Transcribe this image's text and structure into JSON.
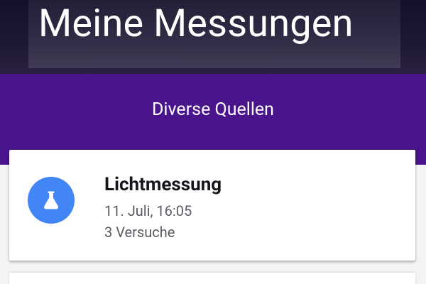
{
  "header": {
    "title": "Meine Messungen"
  },
  "section": {
    "title": "Diverse Quellen"
  },
  "measurements": [
    {
      "title": "Lichtmessung",
      "date": "11. Juli, 16:05",
      "attempts": "3 Versuche",
      "icon": "flask-icon",
      "icon_bg_color": "#4285f4"
    }
  ],
  "colors": {
    "header_bg": "#1d1733",
    "section_bg": "#4a148c",
    "card_bg": "#ffffff",
    "page_bg": "#f4f4f6"
  }
}
